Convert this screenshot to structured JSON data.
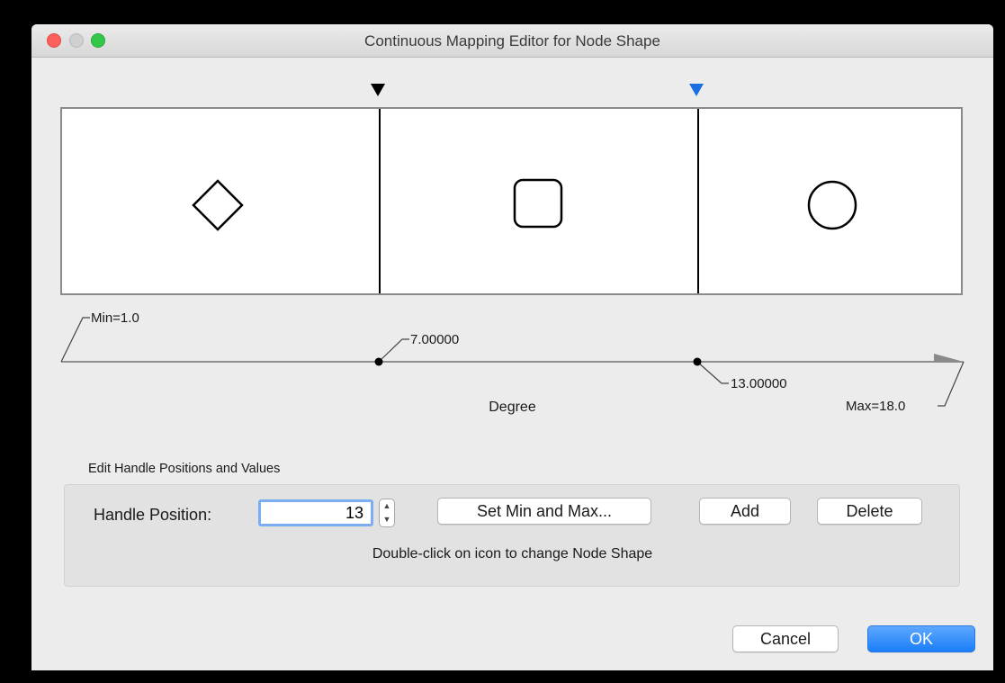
{
  "window": {
    "title": "Continuous Mapping Editor for Node Shape"
  },
  "editor": {
    "regions": [
      {
        "shape_icon": "diamond-icon"
      },
      {
        "shape_icon": "rounded-square-icon"
      },
      {
        "shape_icon": "circle-icon"
      }
    ],
    "handles": [
      {
        "value": 7.0,
        "label": "7.00000",
        "marker_color": "#000000"
      },
      {
        "value": 13.0,
        "label": "13.00000",
        "marker_color": "#1a6fe0"
      }
    ],
    "min_label": "Min=1.0",
    "max_label": "Max=18.0",
    "axis_title": "Degree"
  },
  "edit_section": {
    "label": "Edit Handle Positions and Values",
    "handle_position_label": "Handle Position:",
    "handle_position_value": "13",
    "set_min_max_label": "Set Min and Max...",
    "add_label": "Add",
    "delete_label": "Delete",
    "hint": "Double-click on icon to change Node Shape"
  },
  "footer": {
    "cancel_label": "Cancel",
    "ok_label": "OK"
  },
  "colors": {
    "accent": "#1a7ef7",
    "selected_handle": "#1a6fe0"
  }
}
